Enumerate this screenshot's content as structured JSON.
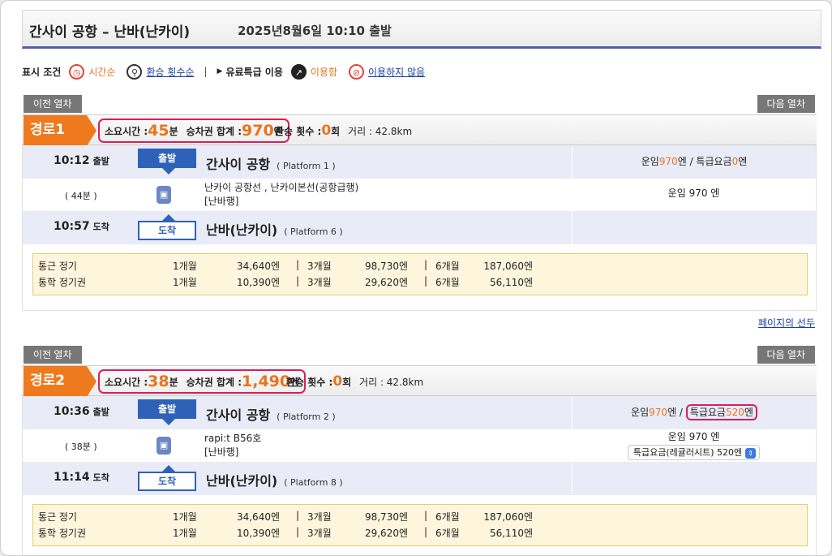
{
  "header": {
    "route_title": "간사이 공항 – 난바(난카이)",
    "datetime": "2025년8월6일 10:10 출발"
  },
  "conditions": {
    "label": "표시 조건",
    "sort_time": "시간순",
    "sort_transfer": "환승 횟수순",
    "separator": "|",
    "express_label": "유료특급 이용",
    "express_use": "이용함",
    "express_nouse": "이용하지 않음"
  },
  "nav": {
    "prev": "이전 열차",
    "next": "다음 열차"
  },
  "page_top": "페이지의 선두",
  "routes": [
    {
      "tag": "경로1",
      "time_label": "소요시간 :",
      "time_value": "45",
      "time_unit": "분",
      "fare_label": "승차권 합계 :",
      "fare_value": "970",
      "fare_unit": "엔",
      "transfer_label": "환승 횟수 :",
      "transfer_value": "0",
      "transfer_unit": "회",
      "distance": "거리 : 42.8km",
      "dep_time": "10:12",
      "dep_label": "출발",
      "dep_badge": "출발",
      "dep_station": "간사이 공항",
      "dep_platform": "( Platform 1 )",
      "fare_breakdown_a": "운임",
      "fare_breakdown_a_val": "970",
      "fare_breakdown_b": "엔 / 특급요금",
      "fare_breakdown_b_val": "0",
      "fare_breakdown_c": "엔",
      "duration": "( 44분 )",
      "line_name": "난카이 공항선 , 난카이본선(공항급행)",
      "direction": "[난바행]",
      "ride_fare": "운임 970 엔",
      "arr_time": "10:57",
      "arr_label": "도착",
      "arr_badge": "도착",
      "arr_station": "난바(난카이)",
      "arr_platform": "( Platform 6 )",
      "passes": [
        {
          "name": "통근 정기",
          "m1": "1개월",
          "p1": "34,640엔",
          "m3": "3개월",
          "p3": "98,730엔",
          "m6": "6개월",
          "p6": "187,060엔"
        },
        {
          "name": "통학 정기권",
          "m1": "1개월",
          "p1": "10,390엔",
          "m3": "3개월",
          "p3": "29,620엔",
          "m6": "6개월",
          "p6": "56,110엔"
        }
      ]
    },
    {
      "tag": "경로2",
      "time_label": "소요시간 :",
      "time_value": "38",
      "time_unit": "분",
      "fare_label": "승차권 합계 :",
      "fare_value": "1,490",
      "fare_unit": "엔",
      "transfer_label": "환승 횟수 :",
      "transfer_value": "0",
      "transfer_unit": "회",
      "distance": "거리 : 42.8km",
      "dep_time": "10:36",
      "dep_label": "출발",
      "dep_badge": "출발",
      "dep_station": "간사이 공항",
      "dep_platform": "( Platform 2 )",
      "fare_breakdown_a": "운임",
      "fare_breakdown_a_val": "970",
      "fare_breakdown_b": "엔 /",
      "fare_breakdown_b2": "특급요금",
      "fare_breakdown_b_val": "520",
      "fare_breakdown_c": "엔",
      "duration": "( 38분 )",
      "line_name": "rapi:t B56호",
      "direction": "[난바행]",
      "ride_fare": "운임 970 엔",
      "seat_select": "특급요금(레귤러시트) 520엔",
      "arr_time": "11:14",
      "arr_label": "도착",
      "arr_badge": "도착",
      "arr_station": "난바(난카이)",
      "arr_platform": "( Platform 8 )",
      "passes": [
        {
          "name": "통근 정기",
          "m1": "1개월",
          "p1": "34,640엔",
          "m3": "3개월",
          "p3": "98,730엔",
          "m6": "6개월",
          "p6": "187,060엔"
        },
        {
          "name": "통학 정기권",
          "m1": "1개월",
          "p1": "10,390엔",
          "m3": "3개월",
          "p3": "29,620엔",
          "m6": "6개월",
          "p6": "56,110엔"
        }
      ]
    }
  ],
  "sep": "|"
}
